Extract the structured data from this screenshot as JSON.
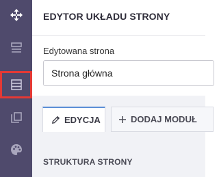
{
  "rail": {
    "items": [
      {
        "icon": "move-icon"
      },
      {
        "icon": "layout-icon"
      },
      {
        "icon": "page-layout-icon",
        "active": true
      },
      {
        "icon": "copy-icon"
      },
      {
        "icon": "palette-icon"
      }
    ],
    "colors": {
      "background": "#4f4a6c",
      "active_border": "#e53935"
    }
  },
  "header": {
    "title": "EDYTOR UKŁADU STRONY"
  },
  "page_field": {
    "label": "Edytowana strona",
    "value": "Strona główna"
  },
  "tabs": [
    {
      "label": "EDYCJA",
      "icon": "pencil-icon",
      "active": true
    },
    {
      "label": "DODAJ MODUŁ",
      "icon": "plus-icon",
      "active": false
    }
  ],
  "section": {
    "title": "STRUKTURA STRONY"
  }
}
